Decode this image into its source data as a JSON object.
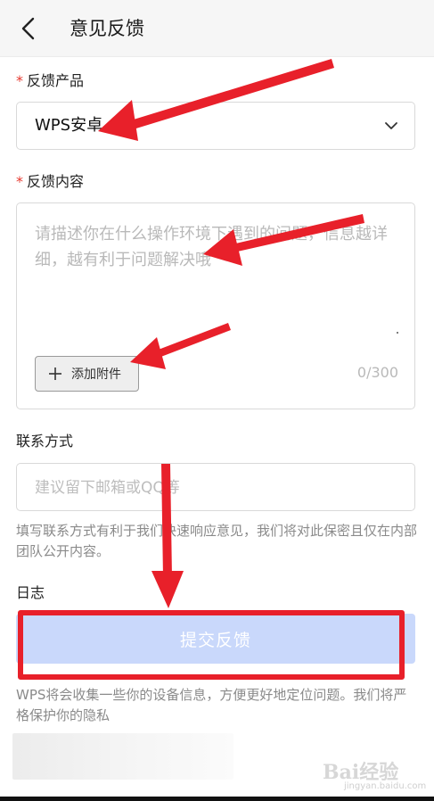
{
  "header": {
    "title": "意见反馈",
    "back_icon": "chevron-left-icon"
  },
  "product": {
    "required_mark": "*",
    "label": "反馈产品",
    "value": "WPS安卓",
    "dropdown_icon": "chevron-down-icon"
  },
  "content": {
    "required_mark": "*",
    "label": "反馈内容",
    "placeholder": "请描述你在什么操作环境下遇到的问题，信息越详细，越有利于问题解决哦",
    "attach_label": "添加附件",
    "counter": "0/300"
  },
  "contact": {
    "label": "联系方式",
    "placeholder": "建议留下邮箱或QQ等",
    "hint": "填写联系方式有利于我们快速响应意见，我们将对此保密且仅在内部团队公开内容。"
  },
  "log": {
    "label": "日志"
  },
  "submit": {
    "label": "提交反馈"
  },
  "privacy_notice": "WPS将会收集一些你的设备信息，方便更好地定位问题。我们将严格保护你的隐私",
  "watermark": {
    "text": "Bai经验",
    "sub": "jingyan.baidu.com"
  },
  "colors": {
    "required": "#e6392f",
    "submit_bg": "#c9d8fb",
    "annotation_red": "#e8202a"
  }
}
